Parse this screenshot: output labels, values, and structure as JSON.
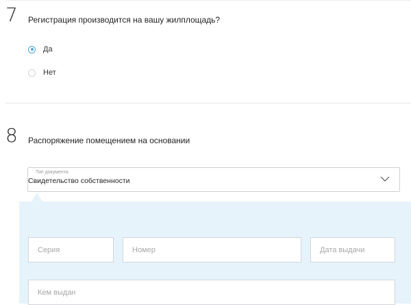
{
  "question7": {
    "number": "7",
    "title": "Регистрация производится на вашу жилплощадь?",
    "options": [
      {
        "label": "Да",
        "selected": true
      },
      {
        "label": "Нет",
        "selected": false
      }
    ]
  },
  "question8": {
    "number": "8",
    "title": "Распоряжение помещением на основании",
    "document_type": {
      "caption": "Тип документа",
      "value": "Свидетельство собственности"
    },
    "fields": {
      "series_placeholder": "Серия",
      "number_placeholder": "Номер",
      "issue_date_placeholder": "Дата выдачи",
      "issued_by_placeholder": "Кем выдан"
    }
  },
  "colors": {
    "accent": "#4aa7d6",
    "panel_background": "#e6f3fb",
    "border": "#cfcfcf"
  }
}
